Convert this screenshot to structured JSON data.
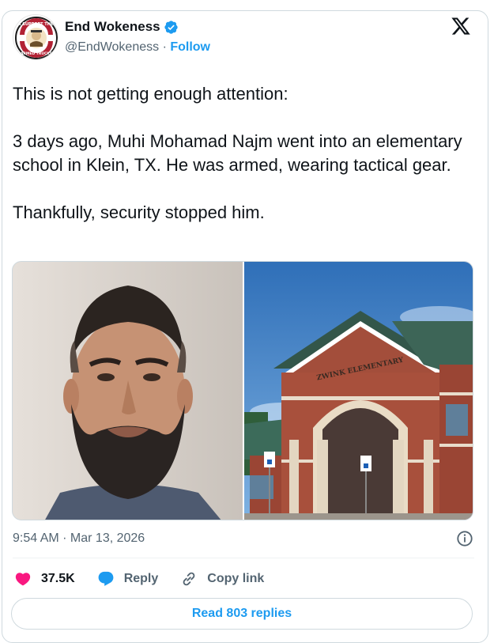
{
  "author": {
    "display_name": "End Wokeness",
    "handle": "@EndWokeness",
    "separator": " · ",
    "follow_label": "Follow",
    "verified": true,
    "avatar_text_top": "I SUPPORT THE",
    "avatar_text_bottom": "ARMED TRUCKS"
  },
  "tweet": {
    "paragraphs": [
      "This is not getting enough attention:",
      "3 days ago, Muhi Mohamad Najm went into an elementary school in Klein, TX. He was armed, wearing tactical gear.",
      "Thankfully, security stopped him."
    ],
    "media_sign_text": "ZWINK ELEMENTARY"
  },
  "meta": {
    "timestamp": "9:54 AM · Mar 13, 2026"
  },
  "actions": {
    "likes": "37.5K",
    "reply_label": "Reply",
    "copy_label": "Copy link"
  },
  "footer": {
    "read_replies_label": "Read 803 replies"
  },
  "colors": {
    "accent": "#1d9bf0",
    "like": "#f91880",
    "text": "#0f1419",
    "muted": "#536471",
    "border": "#cfd9de"
  }
}
